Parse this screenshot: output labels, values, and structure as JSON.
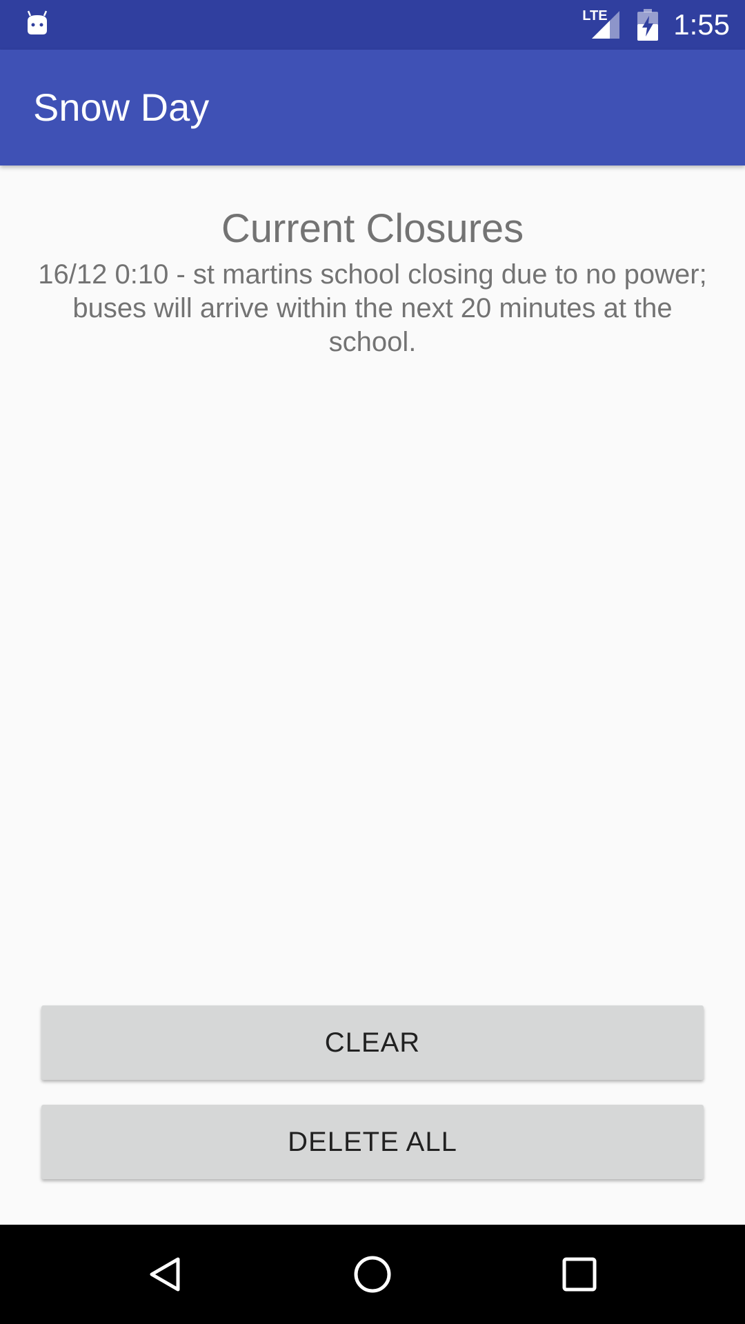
{
  "status_bar": {
    "time": "1:55",
    "network_label": "LTE",
    "icons": [
      "android-notification-icon",
      "lte-signal-icon",
      "battery-charging-icon"
    ]
  },
  "app_bar": {
    "title": "Snow Day"
  },
  "main": {
    "heading": "Current Closures",
    "closures": [
      "16/12 0:10 - st martins school closing due to no power; buses will arrive within the next 20 minutes at the school."
    ]
  },
  "buttons": {
    "clear_label": "CLEAR",
    "delete_all_label": "DELETE ALL"
  },
  "nav_bar": {
    "icons": [
      "back-icon",
      "home-icon",
      "recents-icon"
    ]
  },
  "colors": {
    "status_bar": "#303f9f",
    "primary": "#3f51b5",
    "background": "#fafafa",
    "button": "#d6d7d7",
    "text_secondary": "#737373"
  }
}
